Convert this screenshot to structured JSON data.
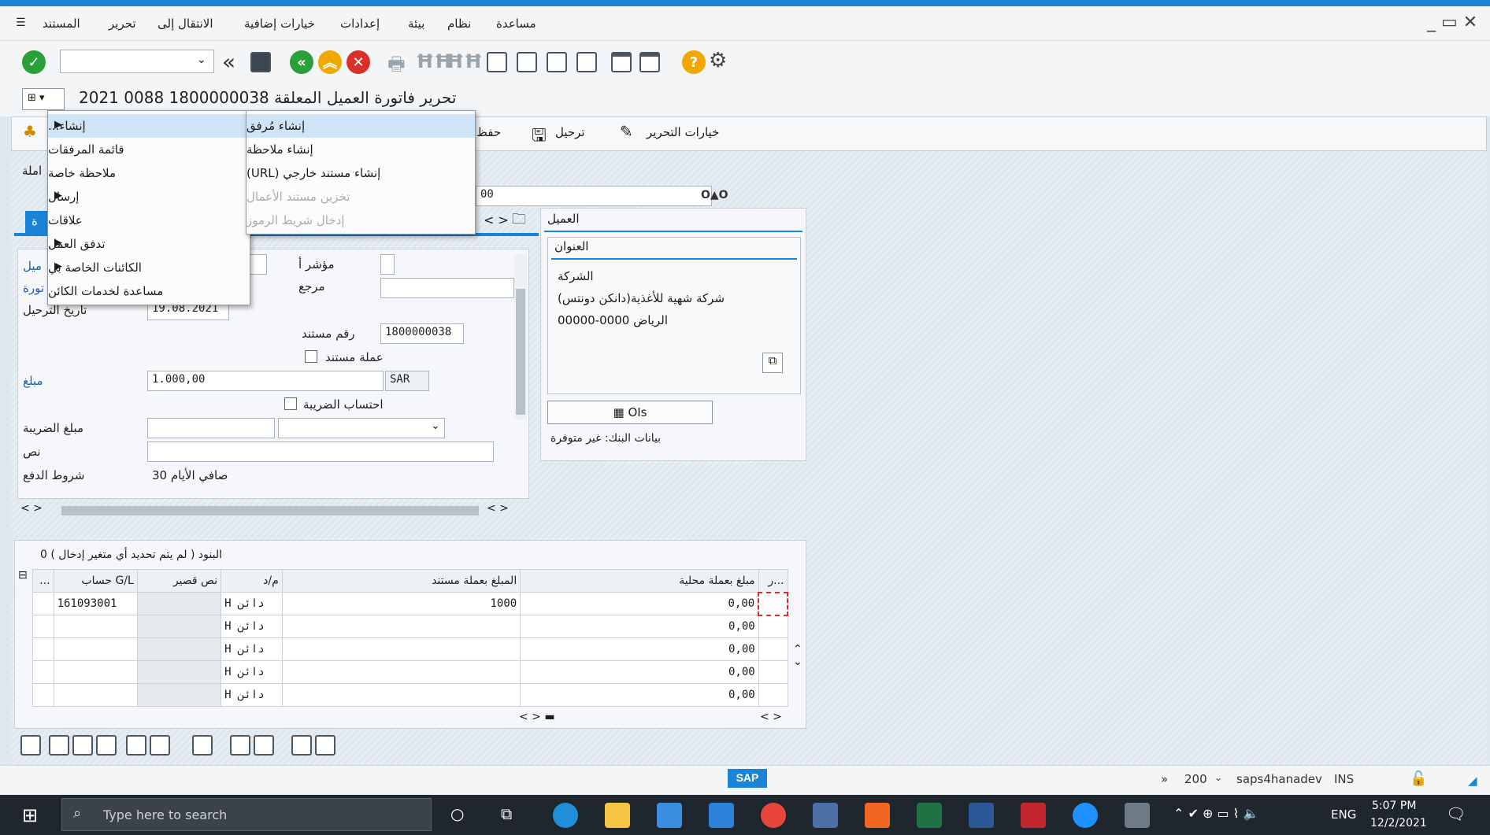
{
  "menubar": {
    "items": [
      "المستند",
      "تحرير",
      "الانتقال إلى",
      "خيارات إضافية",
      "إعدادات",
      "بيئة",
      "نظام",
      "مساعدة"
    ],
    "window_controls": "_ ▭ ✕"
  },
  "toolbar1": {
    "command_field": "",
    "icons": [
      "enter-icon",
      "back-icon",
      "exit-icon",
      "cancel-icon",
      "print-icon",
      "find-icon",
      "help-icon",
      "settings-icon"
    ]
  },
  "title": {
    "text": "تحرير فاتورة العميل المعلقة 1800000038 0088 2021"
  },
  "toolbar2": {
    "post_label": "ترحيل",
    "save_label": "حفظ",
    "edit_options_label": "خيارات التحرير"
  },
  "gos_menu": {
    "items": [
      {
        "label": "...إنشاء",
        "submenu": true
      },
      {
        "label": "قائمة المرفقات",
        "submenu": false
      },
      {
        "label": "ملاحظة خاصة",
        "submenu": false
      },
      {
        "label": "إرسال",
        "submenu": true
      },
      {
        "label": "علاقات",
        "submenu": false
      },
      {
        "label": "تدفق العمل",
        "submenu": true
      },
      {
        "label": "الكائنات الخاصة بي",
        "submenu": true
      },
      {
        "label": "مساعدة لخدمات الكائن",
        "submenu": false
      }
    ]
  },
  "create_submenu": {
    "items": [
      {
        "label": "إنشاء مُرفق",
        "disabled": false
      },
      {
        "label": "إنشاء ملاحظة",
        "disabled": false
      },
      {
        "label": "(URL) إنشاء مستند خارجي",
        "disabled": false
      },
      {
        "label": "تخزين مستند الأعمال",
        "disabled": true
      },
      {
        "label": "إدخال شريط الرموز",
        "disabled": true
      }
    ]
  },
  "header": {
    "transaction_label": "املة",
    "partial_field": "00",
    "tab_partial": "ة"
  },
  "form": {
    "left_link_1": "ميل",
    "left_link_2": "تورة",
    "indicator_label": "مؤشر أ",
    "reference_label": "مرجع",
    "posting_date_label": "تاريخ الترحيل",
    "posting_date": "19.08.2021",
    "doc_number_label": "رقم مستند",
    "doc_number": "1800000038",
    "doc_currency_label": "عملة مستند",
    "amount_label": "مبلغ",
    "amount": "1.000,00",
    "currency": "SAR",
    "calc_tax_label": "احتساب الضريبة",
    "tax_amount_label": "مبلغ الضريبة",
    "text_label": "نص",
    "payment_terms_label": "شروط الدفع",
    "payment_terms": "صافي الأيام 30"
  },
  "customer": {
    "tab": "العميل",
    "address_tab": "العنوان",
    "company": "الشركة",
    "name": "شركة شهية للأغذية(دانكن دونتس)",
    "city": "الرياض 0000-00000",
    "ois_button": "OIs",
    "bank_data": "بيانات البنك: غير متوفرة"
  },
  "items": {
    "title": "البنود ( لم يتم تحديد أي متغير إدخال ) 0",
    "columns": [
      "...",
      "حساب G/L",
      "نص قصير",
      "م/د",
      "المبلغ بعملة مستند",
      "مبلغ بعملة محلية",
      "ر..."
    ],
    "rows": [
      {
        "account": "161093001",
        "short_text": "",
        "dc": "H دائن",
        "doc_amount": "1000",
        "local_amount": "0,00"
      },
      {
        "account": "",
        "short_text": "",
        "dc": "H دائن",
        "doc_amount": "",
        "local_amount": "0,00"
      },
      {
        "account": "",
        "short_text": "",
        "dc": "H دائن",
        "doc_amount": "",
        "local_amount": "0,00"
      },
      {
        "account": "",
        "short_text": "",
        "dc": "H دائن",
        "doc_amount": "",
        "local_amount": "0,00"
      },
      {
        "account": "",
        "short_text": "",
        "dc": "H دائن",
        "doc_amount": "",
        "local_amount": "0,00"
      }
    ]
  },
  "statusbar": {
    "sap_logo": "SAP",
    "client": "200",
    "system": "saps4hanadev",
    "mode": "INS"
  },
  "taskbar": {
    "search_placeholder": "Type here to search",
    "language": "ENG",
    "time": "5:07 PM",
    "date": "12/2/2021"
  },
  "colors": {
    "accent": "#1a84d6",
    "green": "#2aa03a",
    "red": "#d8312a",
    "yellow": "#f0a800"
  }
}
